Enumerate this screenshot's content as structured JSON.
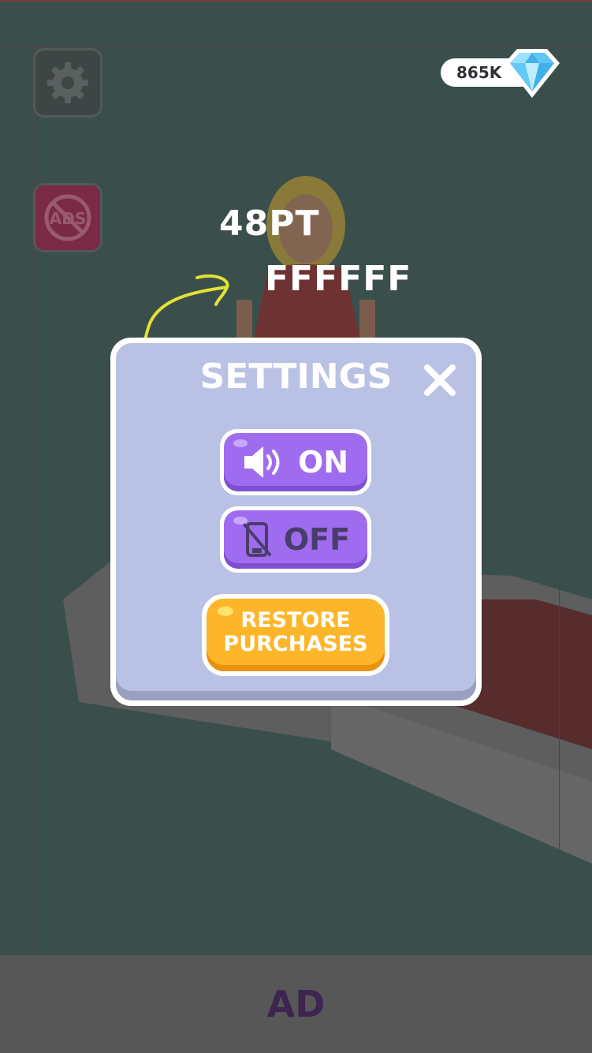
{
  "currency": {
    "amount": "865K",
    "icon": "diamond-icon"
  },
  "annotations": {
    "font_size": "48PT",
    "font_color": "FFFFFF"
  },
  "settings": {
    "title": "SETTINGS",
    "sound_label": "ON",
    "vibration_label": "OFF",
    "restore_label_line1": "RESTORE",
    "restore_label_line2": "PURCHASES"
  },
  "ad_banner": {
    "label": "AD"
  },
  "colors": {
    "dialog_bg": "#b9c2e5",
    "toggle_button": "#9f6cf0",
    "restore_button": "#fdb629",
    "annotation_arrow": "#e4e236"
  }
}
